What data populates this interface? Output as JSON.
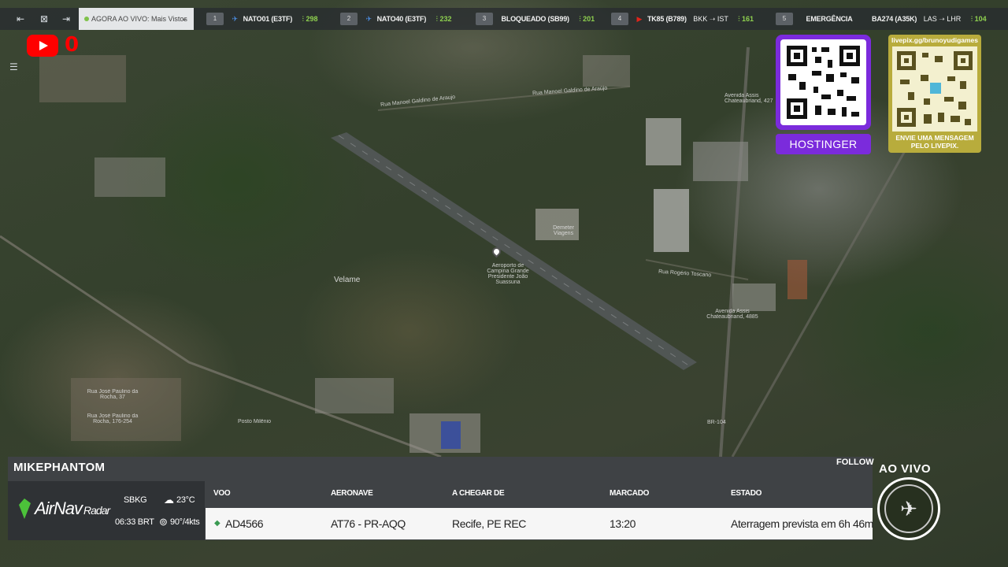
{
  "topbar": {
    "live_selector": "AGORA AO VIVO: Mais Vistos",
    "tabs": [
      {
        "num": "1",
        "label": "NATO01 (E3TF)",
        "signal": "298"
      },
      {
        "num": "2",
        "label": "NATO40 (E3TF)",
        "signal": "232"
      },
      {
        "num": "3",
        "label": "BLOQUEADO (SB99)",
        "signal": "201"
      },
      {
        "num": "4",
        "label": "TK85 (B789)",
        "route_from": "BKK",
        "route_to": "IST",
        "signal": "161"
      },
      {
        "num": "5",
        "label": "EMERGÊNCIA",
        "label2": "BA274 (A35K)",
        "route_from": "LAS",
        "route_to": "LHR",
        "signal": "104"
      }
    ]
  },
  "youtube": {
    "count": "0"
  },
  "ads": {
    "hostinger_label": "HOSTINGER",
    "livepix_url": "livepix.gg/brunoyudigames",
    "livepix_message": "ENVIE UMA MENSAGEM PELO LIVEPIX."
  },
  "map_labels": {
    "rua_manoel": "Rua Manoel Galdino de Araujo",
    "rua_manoel2": "Rua Manoel Galdino de Araújo",
    "avenida_assis": "Avenida Assis Chateaubriand, 427",
    "airport": "Aeroporto de Campina Grande Presidente João Suassuna",
    "velame": "Velame",
    "rua_rogerio": "Rua Rogério Toscano",
    "avenida_assis2": "Avenida Assis Chateaubriand, 4885",
    "rua_jose_paulino": "Rua José Paulino da Rocha, 37",
    "rua_jose_paulino2": "Rua José Paulino da Rocha, 176-254",
    "posto": "Posto Milênio",
    "br104": "BR-104",
    "terminal": "Demeter Viagens"
  },
  "panel": {
    "username": "MIKEPHANTOM",
    "brand": "AirNav",
    "brand_suffix": "Radar",
    "airport_code": "SBKG",
    "local_time": "06:33 BRT",
    "temperature": "23°C",
    "wind": "90°/4kts",
    "headers": {
      "flight": "VOO",
      "aircraft": "AERONAVE",
      "from": "A CHEGAR DE",
      "scheduled": "MARCADO",
      "status": "ESTADO"
    },
    "row": {
      "flight": "AD4566",
      "aircraft": "AT76 - PR-AQQ",
      "from": "Recife, PE REC",
      "scheduled": "13:20",
      "status": "Aterragem prevista em 6h 46m"
    },
    "follow": "FOLLOW",
    "live": "AO VIVO"
  },
  "colors": {
    "youtube": "#ff0000",
    "hostinger": "#7b2bdc",
    "livepix": "#b8ac3c",
    "signal": "#8fd14f"
  }
}
